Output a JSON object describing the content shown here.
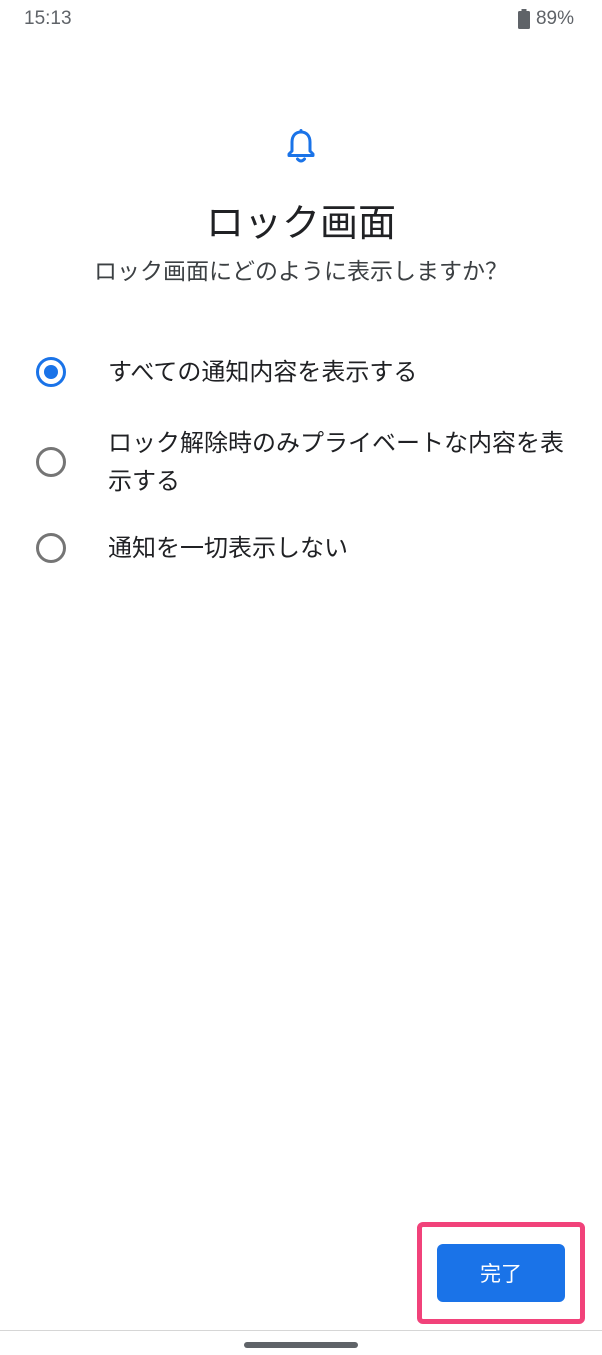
{
  "status_bar": {
    "time": "15:13",
    "battery_percent": "89%",
    "battery_icon": "battery-icon"
  },
  "header": {
    "icon": "bell-icon",
    "title": "ロック画面",
    "subtitle": "ロック画面にどのように表示しますか？"
  },
  "options": [
    {
      "label": "すべての通知内容を表示する",
      "selected": true
    },
    {
      "label": "ロック解除時のみプライベートな内容を表示する",
      "selected": false
    },
    {
      "label": "通知を一切表示しない",
      "selected": false
    }
  ],
  "footer": {
    "done_label": "完了"
  },
  "colors": {
    "accent": "#1a73e8",
    "highlight": "#f1427a"
  }
}
